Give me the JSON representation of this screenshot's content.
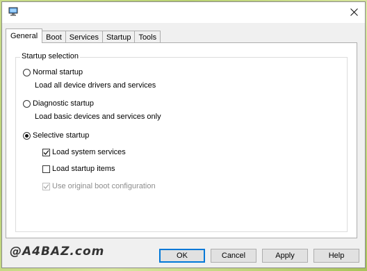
{
  "window": {
    "close_symbol": "✕"
  },
  "tabs": [
    {
      "label": "General",
      "active": true
    },
    {
      "label": "Boot",
      "active": false
    },
    {
      "label": "Services",
      "active": false
    },
    {
      "label": "Startup",
      "active": false
    },
    {
      "label": "Tools",
      "active": false
    }
  ],
  "startup_selection": {
    "legend": "Startup selection",
    "normal": {
      "label": "Normal startup",
      "description": "Load all device drivers and services",
      "selected": false
    },
    "diagnostic": {
      "label": "Diagnostic startup",
      "description": "Load basic devices and services only",
      "selected": false
    },
    "selective": {
      "label": "Selective startup",
      "selected": true
    },
    "load_system_services": {
      "label": "Load system services",
      "checked": true
    },
    "load_startup_items": {
      "label": "Load startup items",
      "checked": false
    },
    "use_original_boot": {
      "label": "Use original boot configuration",
      "checked": true,
      "disabled": true
    }
  },
  "watermark": "@A4BAZ.com",
  "buttons": {
    "ok": "OK",
    "cancel": "Cancel",
    "apply": "Apply",
    "help": "Help"
  },
  "colors": {
    "accent": "#0078d7",
    "disabled_text": "#8d8d8d"
  }
}
